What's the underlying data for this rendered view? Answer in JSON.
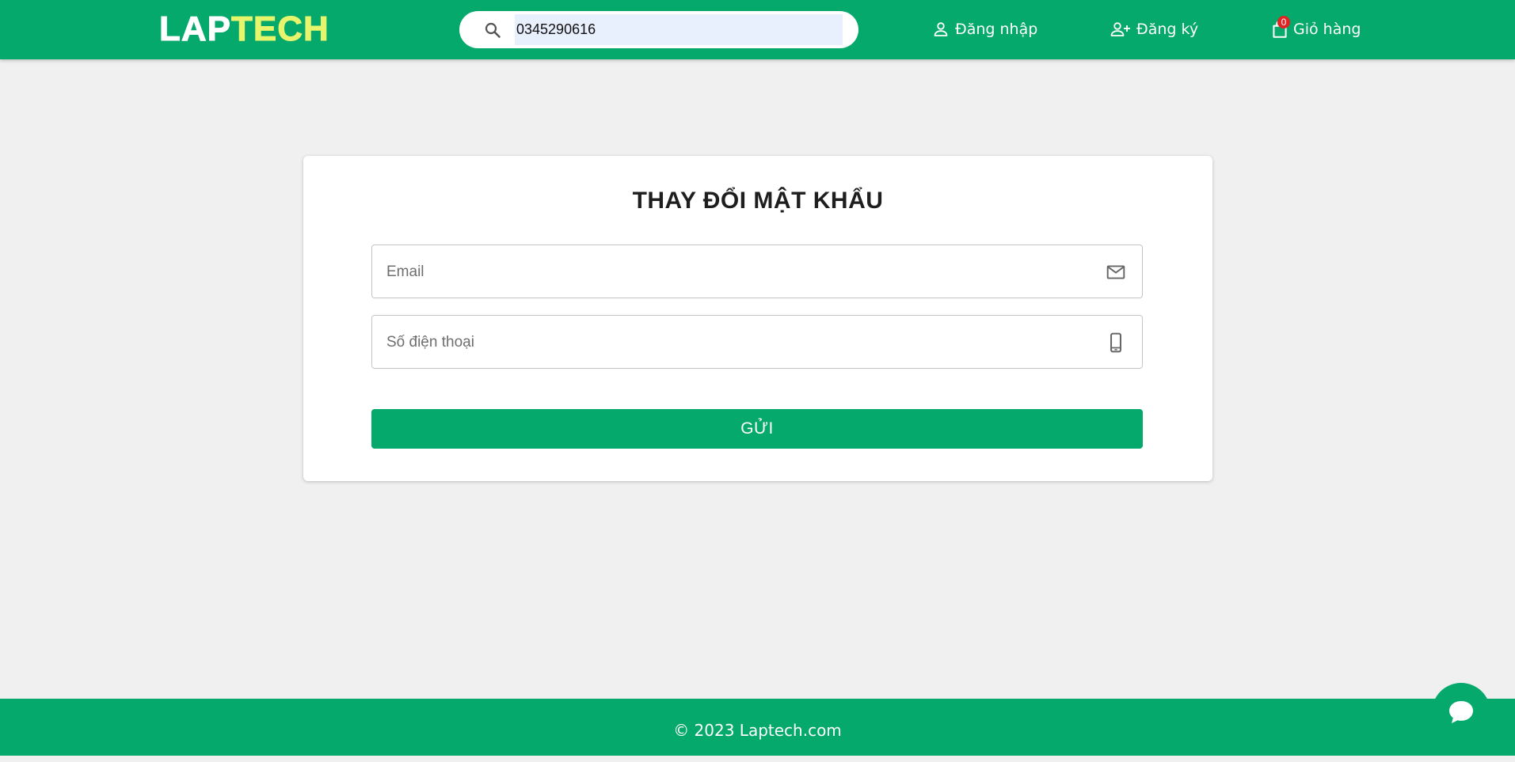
{
  "header": {
    "logo_part1": "LAP",
    "logo_part2": "TECH",
    "search": {
      "value": "0345290616",
      "icon": "search-icon"
    },
    "nav": {
      "login_label": "Đăng nhập",
      "register_label": "Đăng ký",
      "cart_label": "Giỏ hàng",
      "cart_count": "0"
    }
  },
  "form": {
    "title": "THAY ĐỔI MẬT KHẨU",
    "email_placeholder": "Email",
    "email_value": "",
    "phone_placeholder": "Số điện thoại",
    "phone_value": "",
    "submit_label": "GỬI"
  },
  "footer": {
    "copyright": "© 2023 Laptech.com"
  },
  "colors": {
    "brand_green": "#05a96b",
    "logo_accent": "#e6f56b",
    "badge_red": "#e02424",
    "page_background": "#f0f0f0"
  },
  "icons": {
    "login": "person-icon",
    "register": "person-add-icon",
    "cart": "shopping-bag-icon",
    "email": "mail-icon",
    "phone": "phone-icon",
    "chat": "chat-bubble-icon"
  }
}
